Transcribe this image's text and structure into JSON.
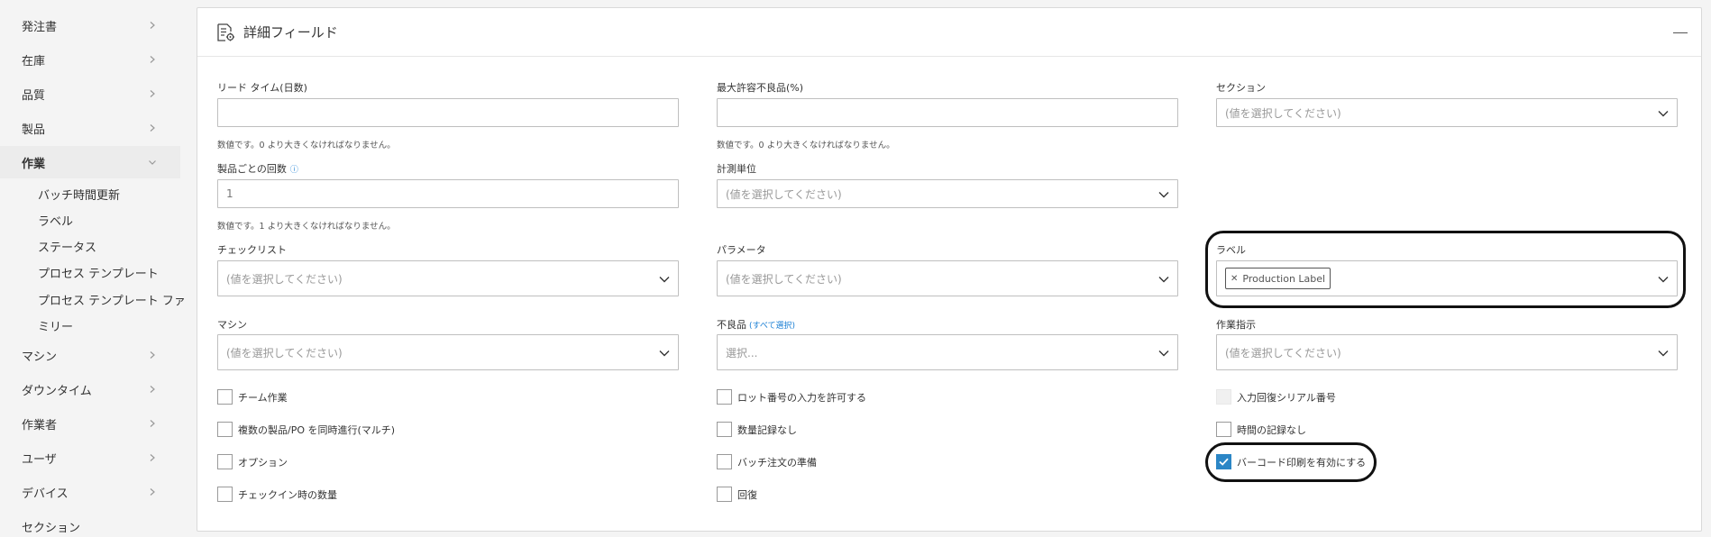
{
  "sidebar": {
    "items": [
      {
        "label": "発注書",
        "expanded": false
      },
      {
        "label": "在庫",
        "expanded": false
      },
      {
        "label": "品質",
        "expanded": false
      },
      {
        "label": "製品",
        "expanded": false
      },
      {
        "label": "作業",
        "expanded": true
      },
      {
        "label": "マシン",
        "expanded": false
      },
      {
        "label": "ダウンタイム",
        "expanded": false
      },
      {
        "label": "作業者",
        "expanded": false
      },
      {
        "label": "ユーザ",
        "expanded": false
      },
      {
        "label": "デバイス",
        "expanded": false
      },
      {
        "label": "セクション",
        "expanded": false
      }
    ],
    "sub_items": [
      "バッチ時間更新",
      "ラベル",
      "ステータス",
      "プロセス テンプレート",
      "プロセス テンプレート ファ",
      "ミリー"
    ]
  },
  "panel": {
    "title": "詳細フィールド",
    "icon": "document-gear-icon",
    "collapse_icon": "minus-icon"
  },
  "fields": {
    "lead_time": {
      "label": "リード タイム(日数)",
      "value": "",
      "hint": "数値です。0 より大きくなければなりません。"
    },
    "max_defect": {
      "label": "最大許容不良品(%)",
      "value": "",
      "hint": "数値です。0 より大きくなければなりません。"
    },
    "section": {
      "label": "セクション",
      "placeholder": "(値を選択してください)"
    },
    "per_product": {
      "label": "製品ごとの回数",
      "info_icon": "ⓘ",
      "value": "1",
      "hint": "数値です。1 より大きくなければなりません。"
    },
    "unit": {
      "label": "計測単位",
      "placeholder": "(値を選択してください)"
    },
    "checklist": {
      "label": "チェックリスト",
      "placeholder": "(値を選択してください)"
    },
    "parameter": {
      "label": "パラメータ",
      "placeholder": "(値を選択してください)"
    },
    "label": {
      "label": "ラベル",
      "tags": [
        "Production Label"
      ]
    },
    "machine": {
      "label": "マシン",
      "placeholder": "(値を選択してください)"
    },
    "defect": {
      "label": "不良品",
      "select_all": "(すべて選択)",
      "placeholder": "選択..."
    },
    "work_instruction": {
      "label": "作業指示",
      "placeholder": "(値を選択してください)"
    }
  },
  "checkboxes": {
    "col1": [
      {
        "label": "チーム作業",
        "checked": false,
        "disabled": false
      },
      {
        "label": "複数の製品/PO を同時進行(マルチ)",
        "checked": false,
        "disabled": false
      },
      {
        "label": "オプション",
        "checked": false,
        "disabled": false
      },
      {
        "label": "チェックイン時の数量",
        "checked": false,
        "disabled": false
      }
    ],
    "col2": [
      {
        "label": "ロット番号の入力を許可する",
        "checked": false,
        "disabled": false
      },
      {
        "label": "数量記録なし",
        "checked": false,
        "disabled": false
      },
      {
        "label": "バッチ注文の準備",
        "checked": false,
        "disabled": false
      },
      {
        "label": "回復",
        "checked": false,
        "disabled": false
      }
    ],
    "col3": [
      {
        "label": "入力回復シリアル番号",
        "checked": false,
        "disabled": true
      },
      {
        "label": "時間の記録なし",
        "checked": false,
        "disabled": false
      },
      {
        "label": "バーコード印刷を有効にする",
        "checked": true,
        "disabled": false
      }
    ]
  },
  "colors": {
    "accent": "#2b86c6",
    "link": "#1a7fd4"
  }
}
